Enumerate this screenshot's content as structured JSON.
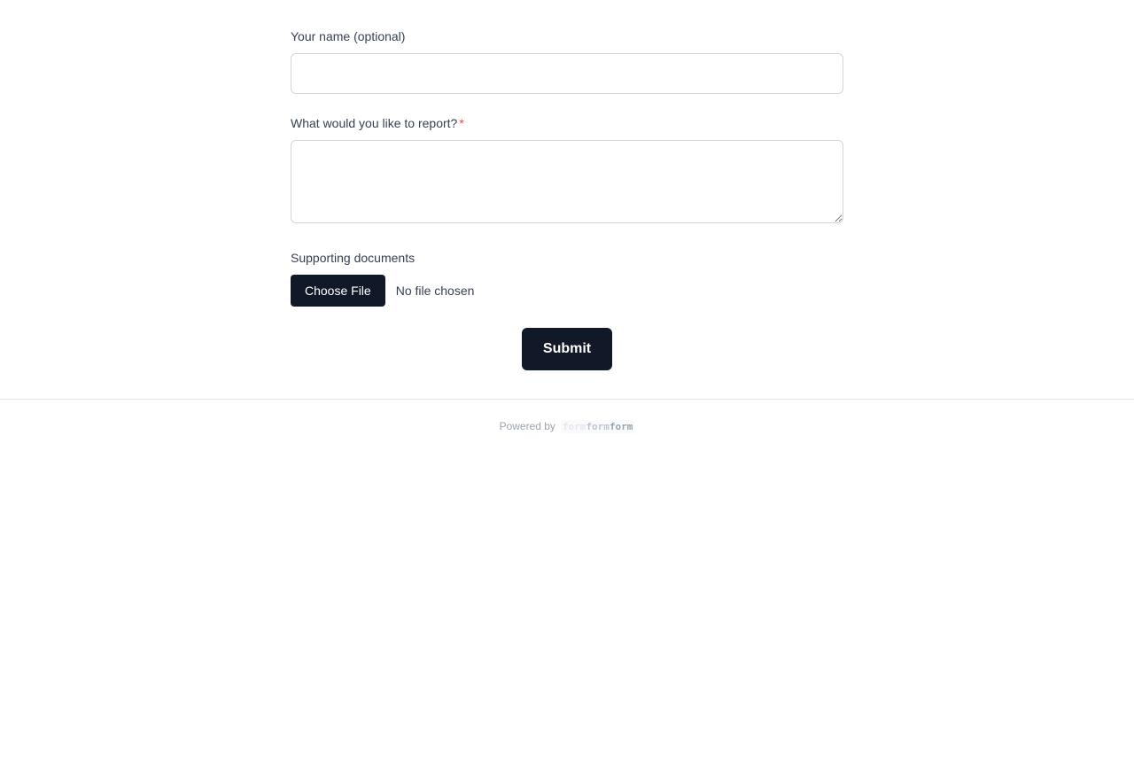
{
  "form": {
    "name_field": {
      "label": "Your name (optional)",
      "value": "",
      "placeholder": ""
    },
    "report_field": {
      "label": "What would you like to report?",
      "required_marker": "*",
      "value": "",
      "placeholder": ""
    },
    "documents_field": {
      "label": "Supporting documents",
      "button_label": "Choose File",
      "status": "No file chosen"
    },
    "submit_label": "Submit"
  },
  "footer": {
    "powered_by": "Powered by",
    "brand_parts": [
      "form",
      "form",
      "form"
    ]
  },
  "colors": {
    "primary": "#111827",
    "required": "#ef4444",
    "border": "#d1d5db"
  }
}
